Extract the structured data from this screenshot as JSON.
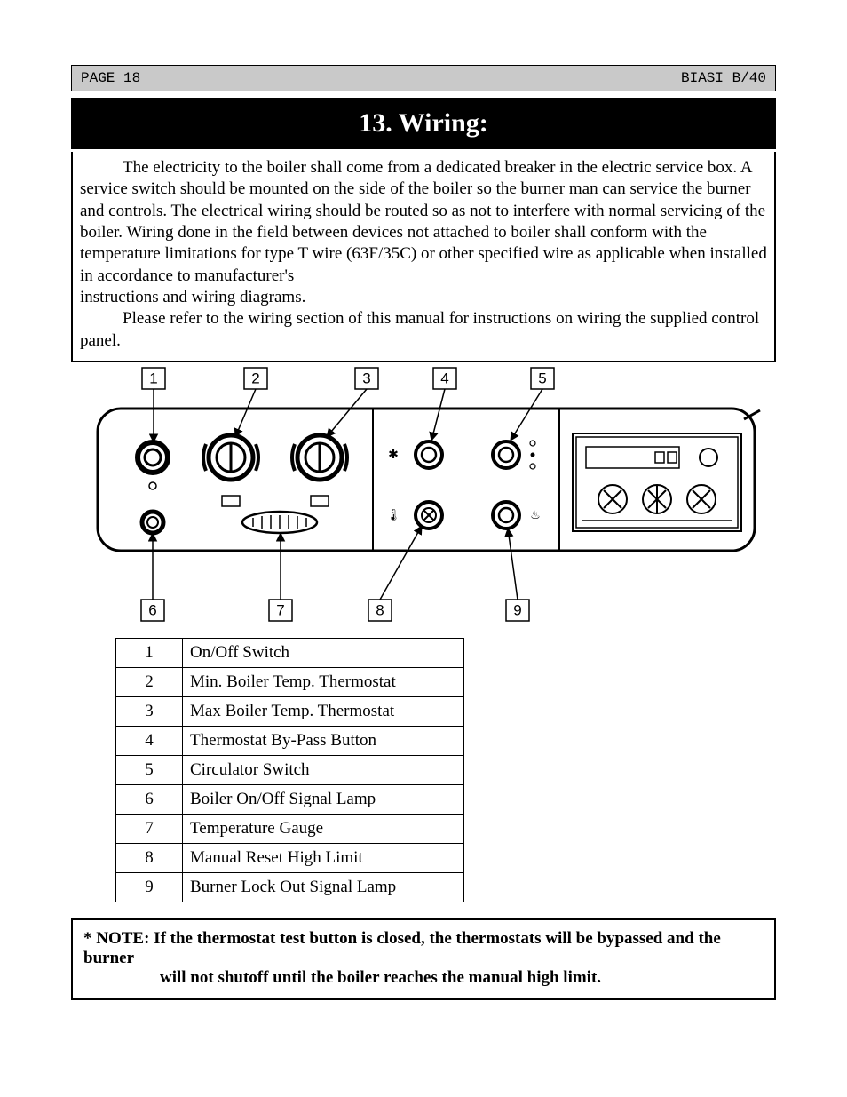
{
  "header": {
    "left": "PAGE 18",
    "right": "BIASI B/40"
  },
  "section": {
    "title": "13.  Wiring:"
  },
  "body": {
    "p1": "The electricity to the boiler shall come from a dedicated breaker in the electric service box. A service switch should be mounted on the side of the boiler so the burner man can service the burner and controls. The electrical wiring should be routed so as not to interfere with normal servicing of the boiler. Wiring done in the field between devices not attached to boiler shall conform with the temperature limitations for type T wire (63F/35C) or other specified wire as applicable when installed in accordance to manufacturer's",
    "p1b": "instructions and wiring diagrams.",
    "p2": "Please refer to the wiring section of this manual for instructions on wiring the supplied control panel."
  },
  "callouts": {
    "c1": "1",
    "c2": "2",
    "c3": "3",
    "c4": "4",
    "c5": "5",
    "c6": "6",
    "c7": "7",
    "c8": "8",
    "c9": "9"
  },
  "legend": [
    {
      "n": "1",
      "d": "On/Off Switch"
    },
    {
      "n": "2",
      "d": "Min. Boiler Temp. Thermostat"
    },
    {
      "n": "3",
      "d": "Max Boiler Temp. Thermostat"
    },
    {
      "n": "4",
      "d": "Thermostat By-Pass Button"
    },
    {
      "n": "5",
      "d": "Circulator Switch"
    },
    {
      "n": "6",
      "d": "Boiler On/Off Signal Lamp"
    },
    {
      "n": "7",
      "d": "Temperature Gauge"
    },
    {
      "n": "8",
      "d": "Manual Reset High Limit"
    },
    {
      "n": "9",
      "d": "Burner Lock Out Signal Lamp"
    }
  ],
  "note": {
    "line1": "* NOTE: If the thermostat test button is closed, the thermostats will be bypassed and the burner",
    "line2": "will not shutoff until the boiler reaches the manual high limit."
  }
}
